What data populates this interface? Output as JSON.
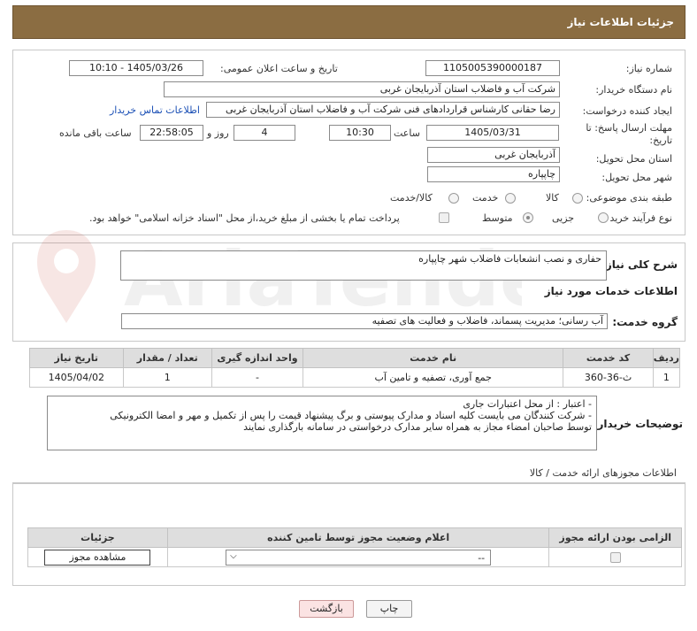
{
  "header": {
    "title": "جزئیات اطلاعات نیاز"
  },
  "form": {
    "need_number_label": "شماره نیاز:",
    "need_number": "1105005390000187",
    "announce_label": "تاریخ و ساعت اعلان عمومی:",
    "announce_value": "1405/03/26 - 10:10",
    "buyer_label": "نام دستگاه خریدار:",
    "buyer_value": "شرکت آب و فاضلاب استان آذربایجان غربی",
    "creator_label": "ایجاد کننده درخواست:",
    "creator_value": "رضا حقانی کارشناس قراردادهای فنی شرکت آب و فاضلاب استان آذربایجان غربی",
    "contact_link": "اطلاعات تماس خریدار",
    "deadline_label_1": "مهلت ارسال پاسخ: تا",
    "deadline_label_2": "تاریخ:",
    "deadline_date": "1405/03/31",
    "time_label": "ساعت",
    "deadline_time": "10:30",
    "days_value": "4",
    "days_label": "روز و",
    "remaining_time": "22:58:05",
    "remaining_label": "ساعت باقی مانده",
    "province_label": "استان محل تحویل:",
    "province_value": "آذربایجان غربی",
    "city_label": "شهر محل تحویل:",
    "city_value": "چاپپاره",
    "category_label": "طبقه بندی موضوعی:",
    "category_options": [
      "کالا",
      "خدمت",
      "کالا/خدمت"
    ],
    "process_label": "نوع فرآیند خرید :",
    "process_options": [
      "جزیی",
      "متوسط"
    ],
    "payment_note": "پرداخت تمام یا بخشی از مبلغ خرید،از محل \"اسناد خزانه اسلامی\" خواهد بود."
  },
  "summary": {
    "label": "شرح کلی نیاز:",
    "value": "حفاری و نصب انشعابات فاضلاب شهر چاپپاره"
  },
  "services": {
    "title": "اطلاعات خدمات مورد نیاز",
    "group_label": "گروه خدمت:",
    "group_value": "آب رسانی؛ مدیریت پسماند، فاضلاب و فعالیت های تصفیه",
    "columns": [
      "ردیف",
      "کد خدمت",
      "نام خدمت",
      "واحد اندازه گیری",
      "تعداد / مقدار",
      "تاریخ نیاز"
    ],
    "rows": [
      [
        "1",
        "ث-36-360",
        "جمع آوری، تصفیه و تامین آب",
        "-",
        "1",
        "1405/04/02"
      ]
    ]
  },
  "notes": {
    "label": "توضیحات خریدار:",
    "lines": [
      "- اعتبار : از محل اعتبارات جاری",
      "- شرکت کنندگان می بایست کلیه اسناد و مدارک پیوستی و برگ پیشنهاد قیمت را پس از تکمیل و مهر و امضا الکترونیکی",
      "توسط صاحبان امضاء مجاز به همراه سایر مدارک درخواستی در سامانه بارگذاری نمایند"
    ]
  },
  "permits": {
    "title": "اطلاعات مجوزهای ارائه خدمت / کالا",
    "columns": [
      "الزامی بودن ارائه مجوز",
      "اعلام وضعیت مجوز توسط تامین کننده",
      "جزئیات"
    ],
    "select_value": "--",
    "view_button": "مشاهده مجوز"
  },
  "actions": {
    "print": "چاپ",
    "back": "بازگشت"
  },
  "watermark": "AriaTender.net"
}
